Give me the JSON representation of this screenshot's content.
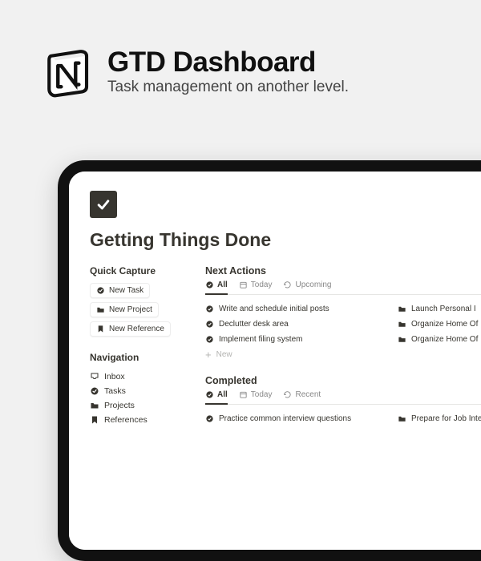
{
  "hero": {
    "title": "GTD Dashboard",
    "subtitle": "Task management on another level."
  },
  "page": {
    "title": "Getting Things Done"
  },
  "quick_capture": {
    "heading": "Quick Capture",
    "buttons": [
      {
        "label": "New Task",
        "icon": "check-circle-icon"
      },
      {
        "label": "New Project",
        "icon": "folder-icon"
      },
      {
        "label": "New Reference",
        "icon": "bookmark-icon"
      }
    ]
  },
  "navigation": {
    "heading": "Navigation",
    "items": [
      {
        "label": "Inbox",
        "icon": "inbox-icon"
      },
      {
        "label": "Tasks",
        "icon": "check-circle-icon"
      },
      {
        "label": "Projects",
        "icon": "folder-icon"
      },
      {
        "label": "References",
        "icon": "bookmark-icon"
      }
    ]
  },
  "next_actions": {
    "heading": "Next Actions",
    "tabs": [
      {
        "label": "All",
        "icon": "check-circle-icon",
        "active": true
      },
      {
        "label": "Today",
        "icon": "calendar-icon",
        "active": false
      },
      {
        "label": "Upcoming",
        "icon": "refresh-icon",
        "active": false
      }
    ],
    "left_rows": [
      "Write and schedule initial posts",
      "Declutter desk area",
      "Implement filing system"
    ],
    "new_label": "New",
    "right_rows": [
      "Launch Personal I",
      "Organize Home Of",
      "Organize Home Of"
    ]
  },
  "completed": {
    "heading": "Completed",
    "tabs": [
      {
        "label": "All",
        "icon": "check-circle-icon",
        "active": true
      },
      {
        "label": "Today",
        "icon": "calendar-icon",
        "active": false
      },
      {
        "label": "Recent",
        "icon": "refresh-icon",
        "active": false
      }
    ],
    "left_rows": [
      "Practice common interview questions"
    ],
    "right_rows": [
      "Prepare for Job Inte"
    ]
  }
}
